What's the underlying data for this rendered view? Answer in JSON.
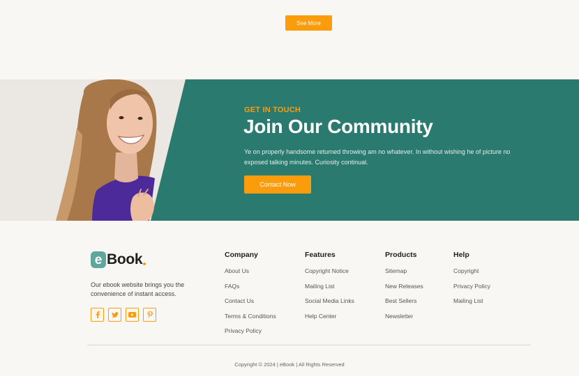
{
  "top": {
    "see_more_label": "See More"
  },
  "join": {
    "eyebrow": "GET IN TOUCH",
    "title": "Join Our Community",
    "description": "Ye on properly handsome returned throwing am no whatever. In without wishing he of picture no exposed talking minutes. Curiosity continual.",
    "contact_label": "Contact Now"
  },
  "footer": {
    "logo_letter": "e",
    "logo_text": "Book",
    "tagline": "Our ebook website brings you the convenience of instant access.",
    "socials": [
      "facebook-icon",
      "twitter-icon",
      "youtube-icon",
      "pinterest-icon"
    ],
    "columns": [
      {
        "title": "Company",
        "links": [
          "About Us",
          "FAQs",
          "Contact Us",
          "Terms & Conditions",
          "Privacy Policy"
        ]
      },
      {
        "title": "Features",
        "links": [
          "Copyright Notice",
          "Mailing List",
          "Social Media Links",
          "Help Center"
        ]
      },
      {
        "title": "Products",
        "links": [
          "Sitemap",
          "New Releases",
          "Best Sellers",
          "Newsletter"
        ]
      },
      {
        "title": "Help",
        "links": [
          "Copyright",
          "Privacy Policy",
          "Mailing List"
        ]
      }
    ],
    "copyright": "Copyright © 2024 | eBook | All Rights Reserved"
  },
  "colors": {
    "accent": "#fb9c0d",
    "teal": "#2b7a70",
    "logo_badge": "#5fa79c",
    "background": "#f8f7f4"
  }
}
